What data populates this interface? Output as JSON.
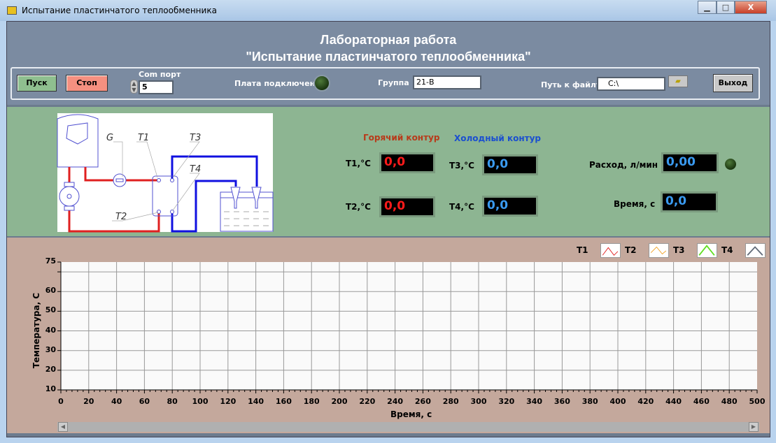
{
  "window": {
    "title": "Испытание пластинчатого теплообменника",
    "minimize": "▁",
    "maximize": "□",
    "close": "X"
  },
  "header": {
    "line1": "Лабораторная работа",
    "line2": "\"Испытание пластинчатого теплообменника\""
  },
  "toolbar": {
    "start": "Пуск",
    "stop": "Стоп",
    "com_label": "Com порт",
    "com_value": "5",
    "board_label": "Плата подключена",
    "group_label": "Группа",
    "group_value": "21-В",
    "path_label": "Путь к файлу",
    "path_value": "C:\\",
    "exit": "Выход"
  },
  "diagram": {
    "labels": [
      "G",
      "T1",
      "T2",
      "T3",
      "T4"
    ]
  },
  "readouts": {
    "hot_title": "Горячий контур",
    "cold_title": "Холодный контур",
    "t1_label": "T1,°C",
    "t1": "0,0",
    "t2_label": "T2,°C",
    "t2": "0,0",
    "t3_label": "T3,°C",
    "t3": "0,0",
    "t4_label": "T4,°C",
    "t4": "0,0",
    "flow_label": "Расход, л/мин",
    "flow": "0,00",
    "time_label": "Время, с",
    "time": "0,0"
  },
  "colors": {
    "hot": "#b83a1a",
    "cold": "#1a4fd0",
    "T1": "#e02020",
    "T2": "#f0a020",
    "T3": "#60e020",
    "T4": "#606a78"
  },
  "chart_data": {
    "type": "line",
    "xlabel": "Время, с",
    "ylabel": "Температура, С",
    "xlim": [
      0,
      500
    ],
    "ylim": [
      10,
      75
    ],
    "xticks": [
      "0",
      "20",
      "40",
      "60",
      "80",
      "100",
      "120",
      "140",
      "160",
      "180",
      "200",
      "220",
      "240",
      "260",
      "280",
      "300",
      "320",
      "340",
      "360",
      "380",
      "400",
      "420",
      "440",
      "460",
      "480",
      "500"
    ],
    "yticks": [
      "75",
      "60",
      "50",
      "40",
      "30",
      "20",
      "10"
    ],
    "legend": [
      "T1",
      "T2",
      "T3",
      "T4"
    ],
    "legend_position": "top-right",
    "grid": true,
    "series": [
      {
        "name": "T1",
        "values": []
      },
      {
        "name": "T2",
        "values": []
      },
      {
        "name": "T3",
        "values": []
      },
      {
        "name": "T4",
        "values": []
      }
    ]
  }
}
